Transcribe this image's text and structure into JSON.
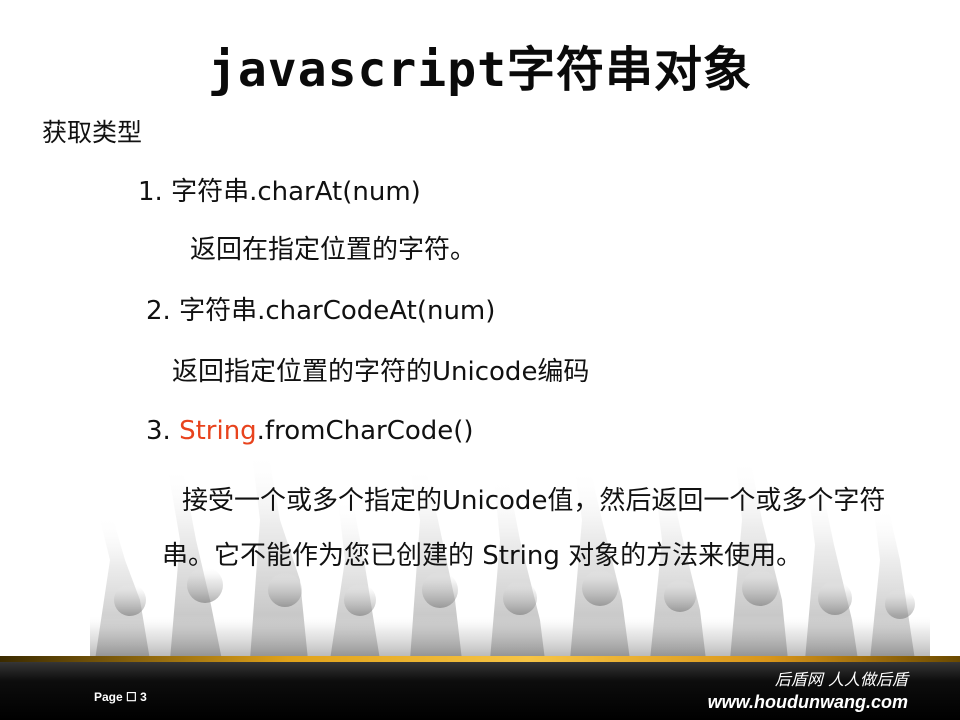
{
  "slide": {
    "title": "javascript字符串对象",
    "subtitle": "获取类型",
    "items": [
      {
        "label": "1.  字符串.charAt(num)",
        "desc": "返回在指定位置的字符。"
      },
      {
        "label": "2. 字符串.charCodeAt(num)",
        "desc": "返回指定位置的字符的Unicode编码"
      },
      {
        "prefix": "3. ",
        "highlight": "String",
        "suffix": ".fromCharCode()",
        "desc": "接受一个或多个指定的Unicode值，然后返回一个或多个字符串。它不能作为您已创建的 String 对象的方法来使用。"
      }
    ]
  },
  "footer": {
    "page_label": "Page ☐ 3",
    "brand_cn": "后盾网 人人做后盾",
    "brand_url": "www.houdunwang.com"
  },
  "colors": {
    "highlight": "#e8431d",
    "footer_background": "#000000",
    "footer_accent": "#f6c445"
  },
  "icons": [
    "crowd-silhouette-background"
  ]
}
